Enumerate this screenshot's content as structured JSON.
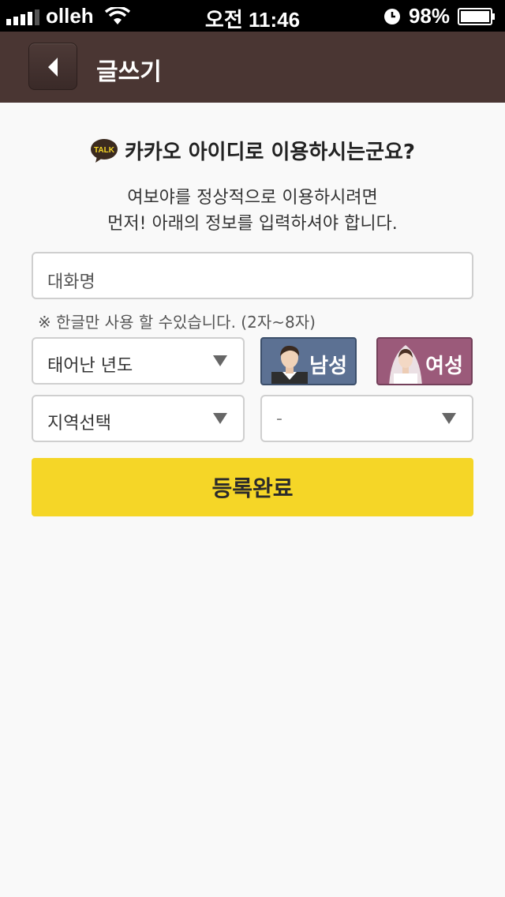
{
  "status_bar": {
    "carrier": "olleh",
    "time": "오전 11:46",
    "battery": "98%"
  },
  "nav": {
    "title": "글쓰기",
    "back_icon": "chevron-left-icon"
  },
  "main": {
    "heading_icon": "kakaotalk-icon",
    "heading_icon_text": "TALK",
    "heading": "카카오 아이디로 이용하시는군요?",
    "intro_line1": "여보야를 정상적으로 이용하시려면",
    "intro_line2": "먼저! 아래의 정보를 입력하셔야 합니다.",
    "nickname_placeholder": "대화명",
    "nickname_hint": "※ 한글만 사용 할 수있습니다. (2자~8자)",
    "birth_year_select": "태어난 년도",
    "gender_male": "남성",
    "gender_female": "여성",
    "region_select": "지역선택",
    "subregion_select": "-",
    "submit_label": "등록완료"
  },
  "colors": {
    "nav_bg": "#4a3633",
    "submit_bg": "#f5d627",
    "male_bg": "#5c7193",
    "female_bg": "#9b5a7a"
  }
}
